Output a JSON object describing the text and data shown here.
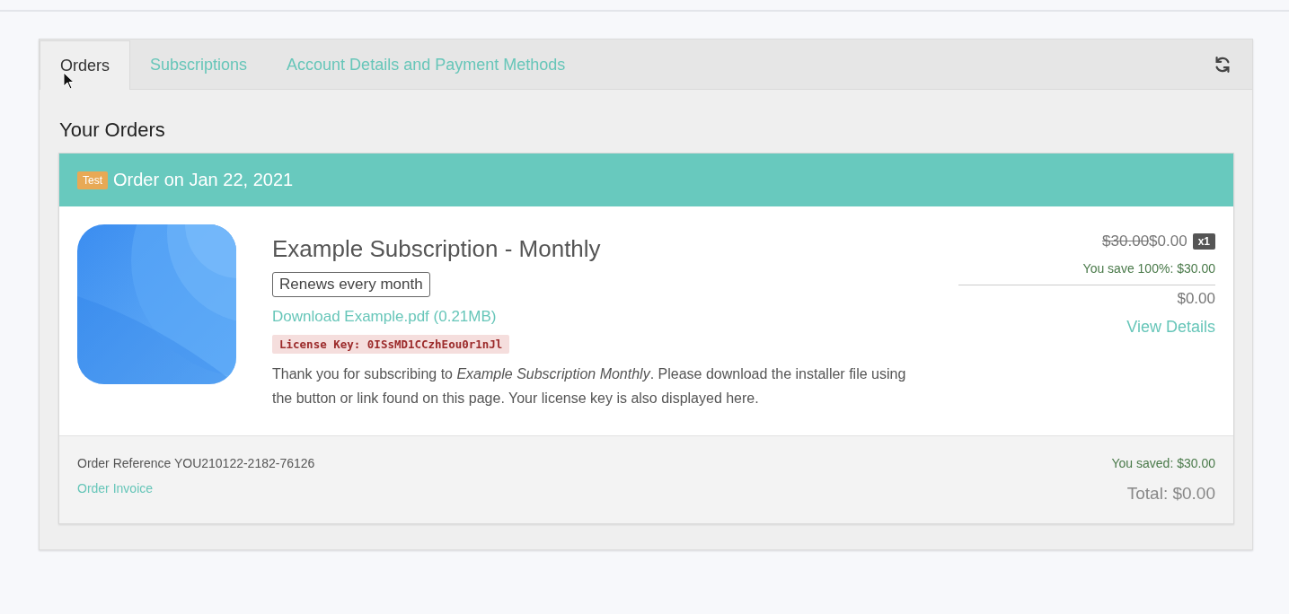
{
  "tabs": [
    {
      "label": "Orders",
      "selected": true
    },
    {
      "label": "Subscriptions",
      "selected": false
    },
    {
      "label": "Account Details and Payment Methods",
      "selected": false
    }
  ],
  "heading": "Your Orders",
  "order": {
    "badge": "Test",
    "title": "Order on Jan 22, 2021",
    "item": {
      "name": "Example Subscription - Monthly",
      "renewal": "Renews every month",
      "download": "Download Example.pdf (0.21MB)",
      "license": "License Key: 0ISsMD1CCzhEou0r1nJl",
      "description": "Thank you for subscribing to *Example Subscription Monthly*. Please download the installer file using the button or link found on this page. Your license key is also displayed here.",
      "old_price": "$30.00",
      "price": "$0.00",
      "quantity": "x1",
      "saving": "You save 100%: $30.00",
      "subtotal": "$0.00",
      "details_link": "View Details"
    },
    "reference": "Order Reference YOU210122-2182-76126",
    "invoice_link": "Order Invoice",
    "saved": "You saved: $30.00",
    "total": "Total: $0.00"
  }
}
